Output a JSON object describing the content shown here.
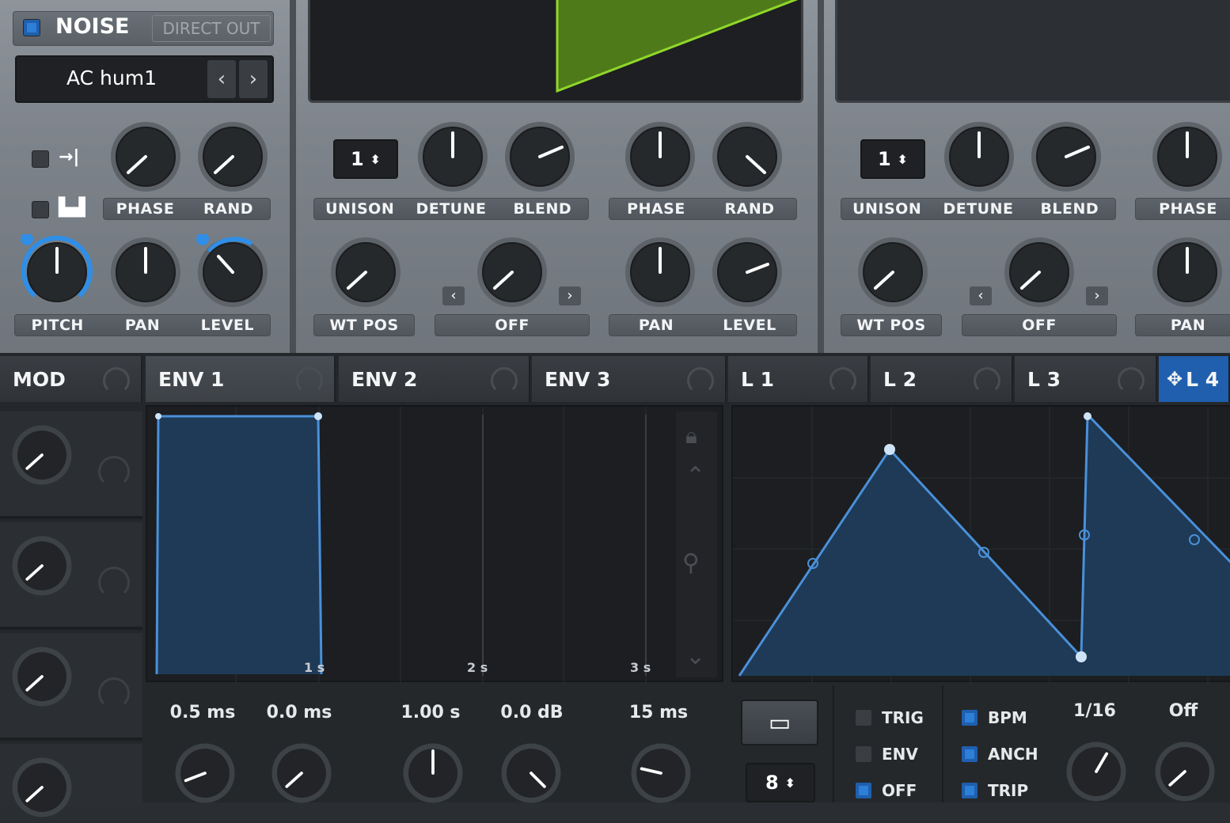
{
  "noise": {
    "title": "NOISE",
    "direct_out": "DIRECT OUT",
    "preset": "AC hum1",
    "row1_labels": [
      "PHASE",
      "RAND"
    ],
    "row2_labels": [
      "PITCH",
      "PAN",
      "LEVEL"
    ]
  },
  "osc_a": {
    "unison_value": "1",
    "row1_labels": [
      "UNISON",
      "DETUNE",
      "BLEND",
      "PHASE",
      "RAND"
    ],
    "row2_labels": [
      "WT POS",
      "OFF",
      "PAN",
      "LEVEL"
    ]
  },
  "osc_b": {
    "unison_value": "1",
    "row1_labels": [
      "UNISON",
      "DETUNE",
      "BLEND",
      "PHASE"
    ],
    "row2_labels": [
      "WT POS",
      "OFF",
      "PAN"
    ]
  },
  "mod_tabs": [
    "MOD",
    "ENV 1",
    "ENV 2",
    "ENV 3",
    "L 1",
    "L 2",
    "L 3",
    "L 4"
  ],
  "env": {
    "time_labels": [
      "1 s",
      "2 s",
      "3 s"
    ],
    "values": [
      "0.5 ms",
      "0.0 ms",
      "1.00 s",
      "0.0 dB",
      "15 ms"
    ]
  },
  "lfo": {
    "options_left": [
      "TRIG",
      "ENV",
      "OFF"
    ],
    "options_right": [
      "BPM",
      "ANCH",
      "TRIP"
    ],
    "grid_value": "8",
    "rate": "1/16",
    "smooth": "Off"
  },
  "colors": {
    "accent": "#2f8ee6",
    "wave_green": "#8fd72a",
    "env_line": "#4a90d9"
  }
}
